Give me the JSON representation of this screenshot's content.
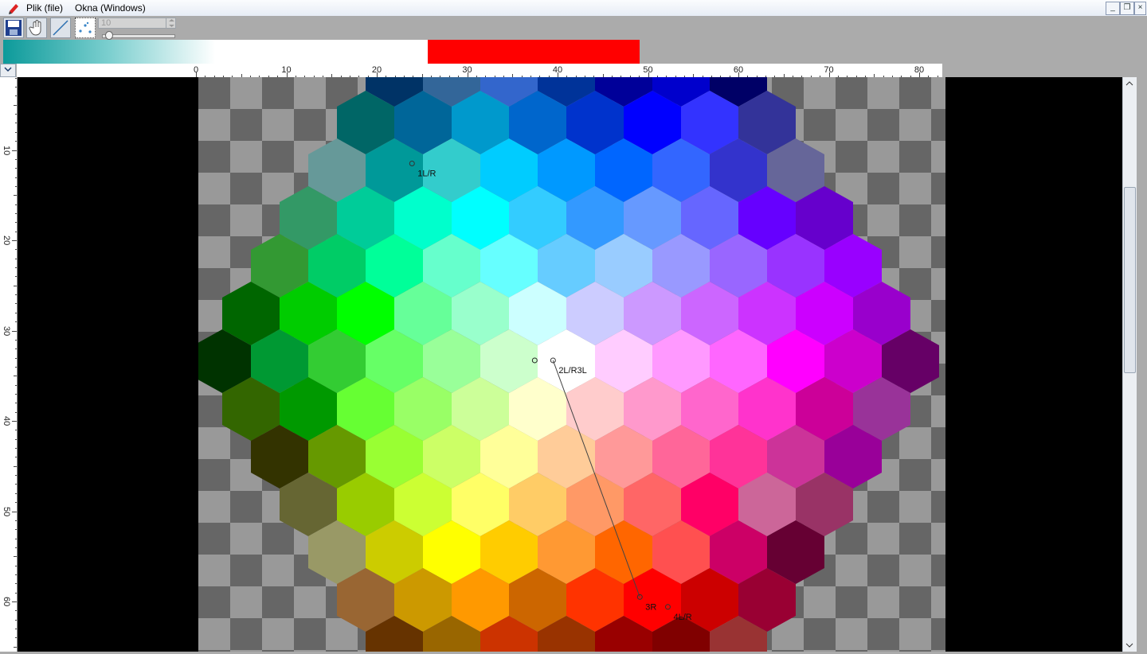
{
  "menubar": {
    "file": "Plik (file)",
    "windows": "Okna (Windows)"
  },
  "icons": {
    "app": "pencil-icon",
    "save": "save-icon",
    "hand": "hand-pan-icon",
    "line": "line-tool-icon",
    "points": "points-tool-icon"
  },
  "toolbar": {
    "size_value": "10",
    "slider_level": 0.05
  },
  "strips": {
    "gradient_colors": [
      "#0c9a9a",
      "#ffffff"
    ],
    "red": "#ff0000"
  },
  "ruler_h": [
    "0",
    "10",
    "20",
    "30",
    "40",
    "50",
    "60",
    "70",
    "80"
  ],
  "ruler_v": [
    "10",
    "20",
    "30",
    "40",
    "50",
    "60"
  ],
  "points": [
    {
      "label": "1L/R",
      "x": 23.9,
      "y": 11.5
    },
    {
      "label": "2L/R3L",
      "x": 39.5,
      "y": 33.3
    },
    {
      "label": "3R",
      "x": 49.1,
      "y": 59.5
    },
    {
      "label": "4L/R",
      "x": 52.2,
      "y": 60.6
    }
  ],
  "hex_colors": [
    [
      "#003366",
      "#336699",
      "#3366cc",
      "#003399",
      "#000099",
      "#0000cc",
      "#000066"
    ],
    [
      "#006666",
      "#006699",
      "#0099cc",
      "#0066cc",
      "#0033cc",
      "#0000ff",
      "#3333ff",
      "#333399"
    ],
    [
      "#669999",
      "#009999",
      "#33cccc",
      "#00ccff",
      "#0099ff",
      "#0066ff",
      "#3366ff",
      "#3333cc",
      "#666699"
    ],
    [
      "#339966",
      "#00cc99",
      "#00ffcc",
      "#00ffff",
      "#33ccff",
      "#3399ff",
      "#6699ff",
      "#6666ff",
      "#6600ff",
      "#6600cc"
    ],
    [
      "#339933",
      "#00cc66",
      "#00ff99",
      "#66ffcc",
      "#66ffff",
      "#66ccff",
      "#99ccff",
      "#9999ff",
      "#9966ff",
      "#9933ff",
      "#9900ff"
    ],
    [
      "#006600",
      "#00cc00",
      "#00ff00",
      "#66ff99",
      "#99ffcc",
      "#ccffff",
      "#ccccff",
      "#cc99ff",
      "#cc66ff",
      "#cc33ff",
      "#cc00ff",
      "#9900cc"
    ],
    [
      "#003300",
      "#009933",
      "#33cc33",
      "#66ff66",
      "#99ff99",
      "#ccffcc",
      "#ffffff",
      "#ffccff",
      "#ff99ff",
      "#ff66ff",
      "#ff00ff",
      "#cc00cc",
      "#660066"
    ],
    [
      "#336600",
      "#009900",
      "#66ff33",
      "#99ff66",
      "#ccff99",
      "#ffffcc",
      "#ffcccc",
      "#ff99cc",
      "#ff66cc",
      "#ff33cc",
      "#cc0099",
      "#993399"
    ],
    [
      "#333300",
      "#669900",
      "#99ff33",
      "#ccff66",
      "#ffff99",
      "#ffcc99",
      "#ff9999",
      "#ff6699",
      "#ff3399",
      "#cc3399",
      "#990099"
    ],
    [
      "#666633",
      "#99cc00",
      "#ccff33",
      "#ffff66",
      "#ffcc66",
      "#ff9966",
      "#ff6666",
      "#ff0066",
      "#cc6699",
      "#993366"
    ],
    [
      "#999966",
      "#cccc00",
      "#ffff00",
      "#ffcc00",
      "#ff9933",
      "#ff6600",
      "#ff5050",
      "#cc0066",
      "#660033"
    ],
    [
      "#996633",
      "#cc9900",
      "#ff9900",
      "#cc6600",
      "#ff3300",
      "#ff0000",
      "#cc0000",
      "#990033"
    ],
    [
      "#663300",
      "#996600",
      "#cc3300",
      "#993300",
      "#990000",
      "#800000",
      "#993333"
    ]
  ]
}
